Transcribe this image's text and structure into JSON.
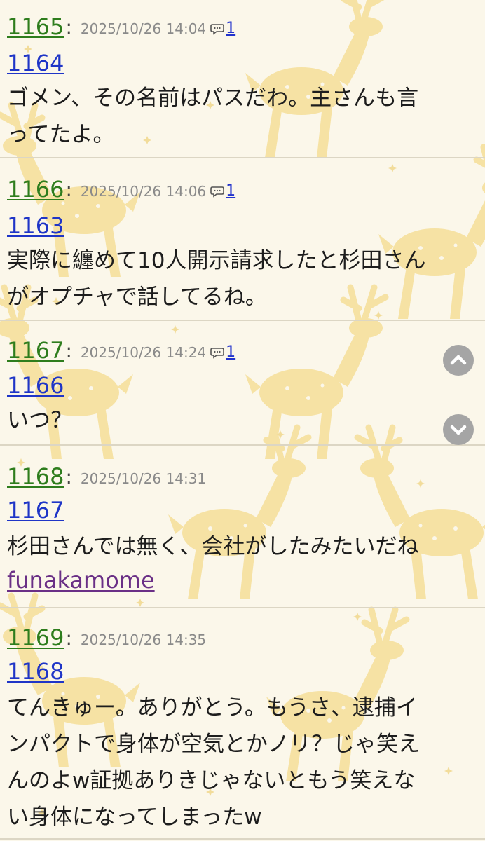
{
  "posts": [
    {
      "number": "1165",
      "colon": ":",
      "date": "2025/10/26 14:04",
      "reply_icon": "speech-bubble-icon",
      "reply_count": "1",
      "anchor": "1164",
      "lines": [
        "ゴメン、その名前はパスだわ。主さんも言",
        "ってたよ。"
      ]
    },
    {
      "number": "1166",
      "colon": ":",
      "date": "2025/10/26 14:06",
      "reply_icon": "speech-bubble-icon",
      "reply_count": "1",
      "anchor": "1163",
      "lines": [
        "実際に纏めて10人開示請求したと杉田さん",
        "がオプチャで話してるね。"
      ]
    },
    {
      "number": "1167",
      "colon": ":",
      "date": "2025/10/26 14:24",
      "reply_icon": "speech-bubble-icon",
      "reply_count": "1",
      "anchor": "1166",
      "lines": [
        "いつ？"
      ]
    },
    {
      "number": "1168",
      "colon": ":",
      "date": "2025/10/26 14:31",
      "anchor": "1167",
      "lines": [
        "杉田さんでは無く、会社がしたみたいだね"
      ],
      "author": "funakamome"
    },
    {
      "number": "1169",
      "colon": ":",
      "date": "2025/10/26 14:35",
      "anchor": "1168",
      "lines": [
        "てんきゅー。ありがとう。もうさ、逮捕イ",
        "ンパクトで身体が空気とかノリ？じゃ笑え",
        "んのよw証拠ありきじゃないともう笑えな",
        "い身体になってしまったw"
      ]
    }
  ],
  "scroll_buttons": {
    "up_icon": "chevron-up-icon",
    "down_icon": "chevron-down-icon"
  },
  "colors": {
    "background": "#fbf7ea",
    "post_number": "#2e7d1d",
    "anchor_link": "#1f35c7",
    "author_link": "#6a2f86",
    "reindeer_pattern": "#f6e2a4"
  },
  "background_icon": "reindeer-pattern"
}
